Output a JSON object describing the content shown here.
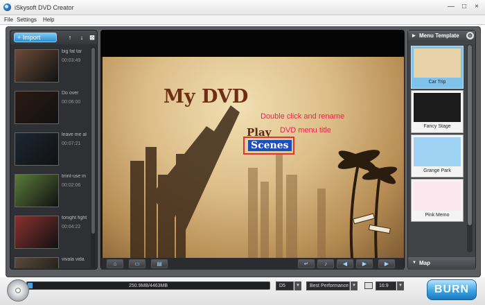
{
  "window": {
    "title": "iSkysoft DVD Creator",
    "min": "—",
    "max": "□",
    "close": "×"
  },
  "menu": [
    "File",
    "Settings",
    "Help"
  ],
  "toolbar": {
    "import_label": "+ Import",
    "up": "↑",
    "down": "↓",
    "remove": "⊠"
  },
  "clips": [
    {
      "name": "big fat tar",
      "duration": "00:03:49",
      "thumb": "#6b4a3a"
    },
    {
      "name": "Do over",
      "duration": "00:06:00",
      "thumb": "#2a1a12"
    },
    {
      "name": "leave me al",
      "duration": "00:07:21",
      "thumb": "#1c2733"
    },
    {
      "name": "tmnt-use m",
      "duration": "00:02:06",
      "thumb": "#5a7a3a"
    },
    {
      "name": "tonight fight",
      "duration": "00:04:22",
      "thumb": "#8a3030"
    },
    {
      "name": "vivala vida",
      "duration": "",
      "thumb": "#5a4a3a"
    }
  ],
  "preview": {
    "title": "My DVD",
    "play": "Play",
    "scenes": "Scenes",
    "hint_line1": "Double click and rename",
    "hint_line2": "DVD menu title"
  },
  "controls": [
    {
      "name": "home-button",
      "icon": "⌂"
    },
    {
      "name": "frame-button",
      "icon": "▭"
    },
    {
      "name": "chapters-button",
      "icon": "▤"
    },
    {
      "name": "back-button",
      "icon": "↵"
    },
    {
      "name": "music-button",
      "icon": "♪"
    },
    {
      "name": "prev-button",
      "icon": "◀"
    },
    {
      "name": "next-button",
      "icon": "▶"
    },
    {
      "name": "play-button",
      "icon": "▶"
    }
  ],
  "menu_template": {
    "header": "Menu Template",
    "templates": [
      {
        "label": "Car Trip",
        "selected": true,
        "color": "#e8d3a8"
      },
      {
        "label": "Fancy Stage",
        "selected": false,
        "color": "#1b1b1b"
      },
      {
        "label": "Grange Park",
        "selected": false,
        "color": "#9fd2f2"
      },
      {
        "label": "Pink Memo",
        "selected": false,
        "color": "#fbe8ee"
      }
    ],
    "map_label": "Map"
  },
  "bottom": {
    "progress_text": "250.9MB/4463MB",
    "progress_fraction": 0.02,
    "disc_type": "D5",
    "quality": "Best Performance",
    "aspect": "16:9",
    "burn_label": "BURN"
  }
}
